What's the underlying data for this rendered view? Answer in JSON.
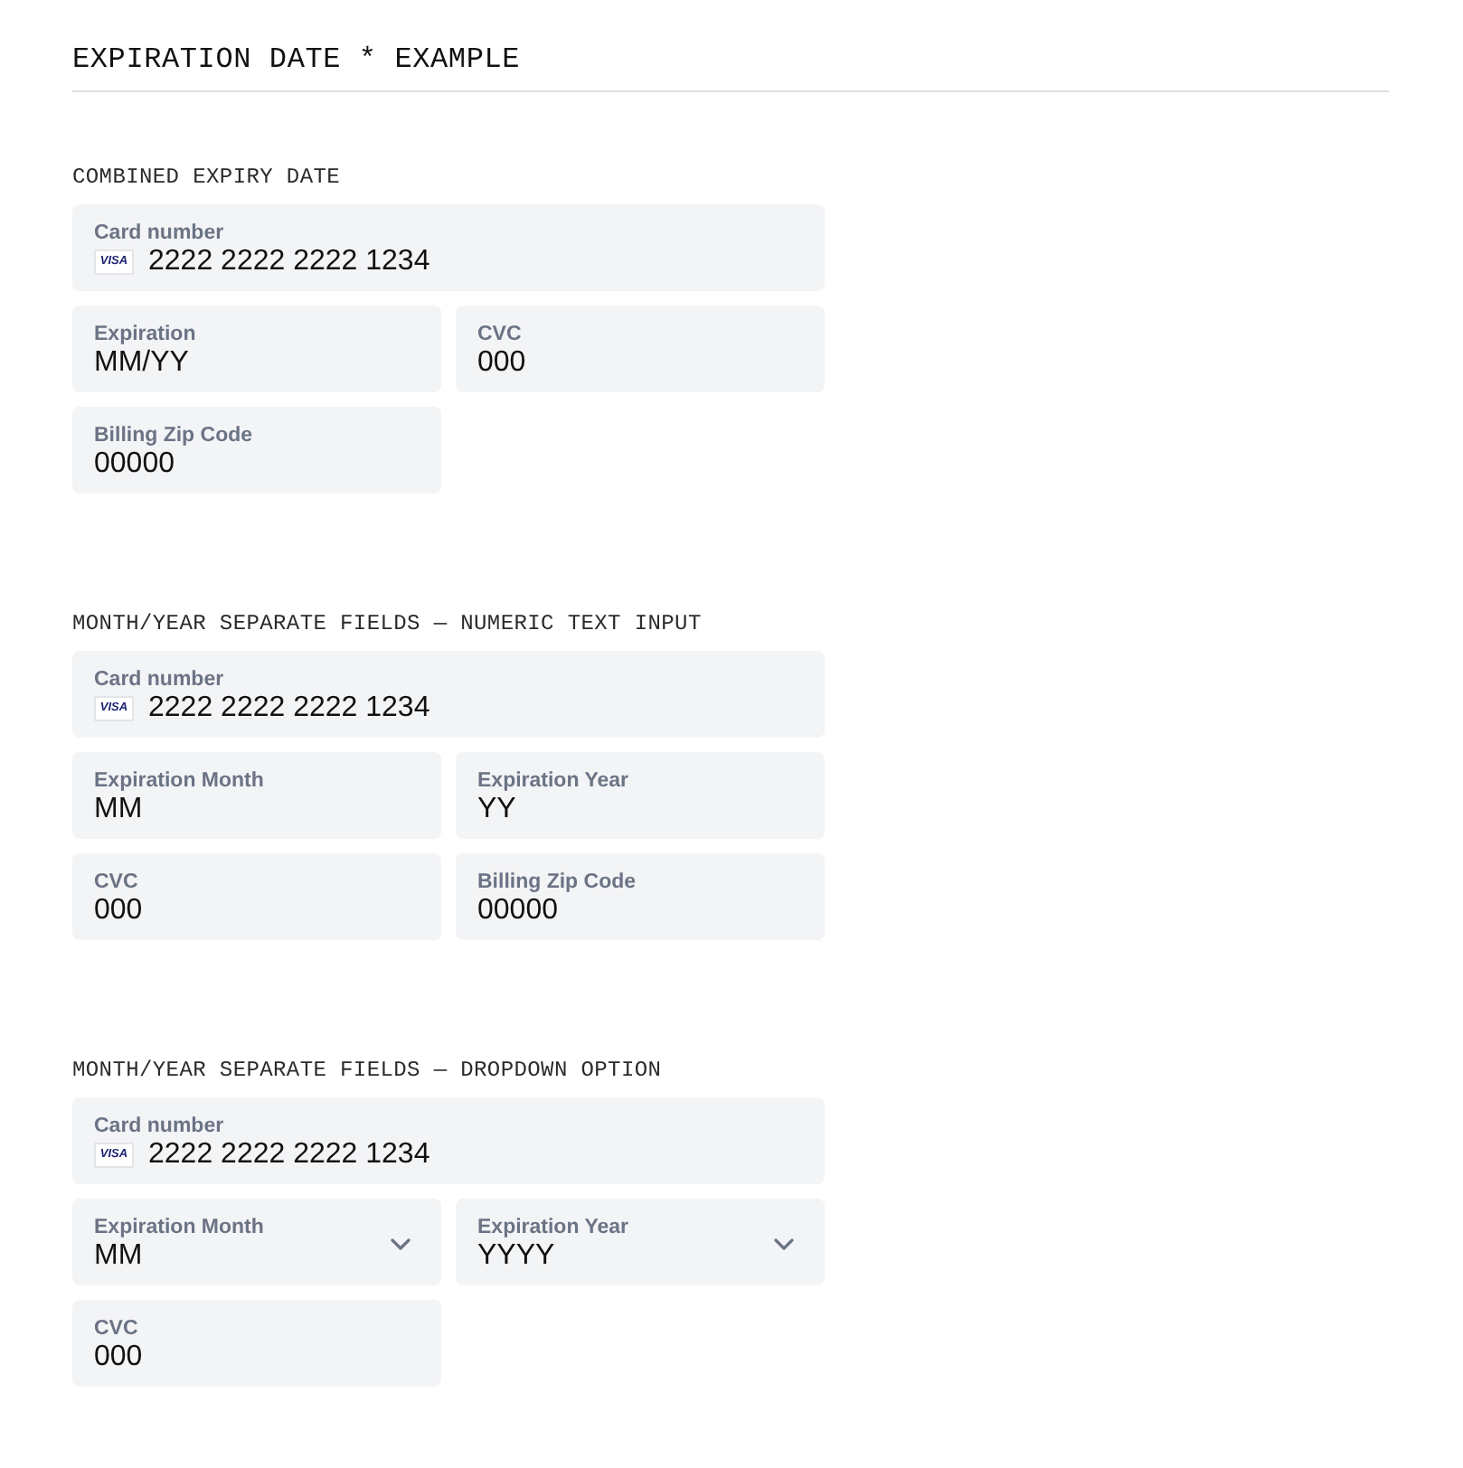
{
  "page": {
    "title": "EXPIRATION DATE * EXAMPLE"
  },
  "sections": [
    {
      "heading": "COMBINED EXPIRY DATE",
      "fields": [
        {
          "kind": "card",
          "label": "Card number",
          "brand": "VISA",
          "value": "2222 2222 2222 1234"
        },
        {
          "kind": "text",
          "label": "Expiration",
          "value": "MM/YY"
        },
        {
          "kind": "text",
          "label": "CVC",
          "value": "000"
        },
        {
          "kind": "text",
          "label": "Billing Zip Code",
          "value": "00000"
        }
      ]
    },
    {
      "heading": "MONTH/YEAR SEPARATE FIELDS — NUMERIC TEXT INPUT",
      "fields": [
        {
          "kind": "card",
          "label": "Card number",
          "brand": "VISA",
          "value": "2222 2222 2222 1234"
        },
        {
          "kind": "text",
          "label": "Expiration Month",
          "value": "MM"
        },
        {
          "kind": "text",
          "label": "Expiration Year",
          "value": "YY"
        },
        {
          "kind": "text",
          "label": "CVC",
          "value": "000"
        },
        {
          "kind": "text",
          "label": "Billing Zip Code",
          "value": "00000"
        }
      ]
    },
    {
      "heading": "MONTH/YEAR SEPARATE FIELDS — DROPDOWN OPTION",
      "fields": [
        {
          "kind": "card",
          "label": "Card number",
          "brand": "VISA",
          "value": "2222 2222 2222 1234"
        },
        {
          "kind": "select",
          "label": "Expiration Month",
          "value": "MM"
        },
        {
          "kind": "select",
          "label": "Expiration Year",
          "value": "YYYY"
        },
        {
          "kind": "text",
          "label": "CVC",
          "value": "000"
        }
      ]
    }
  ]
}
